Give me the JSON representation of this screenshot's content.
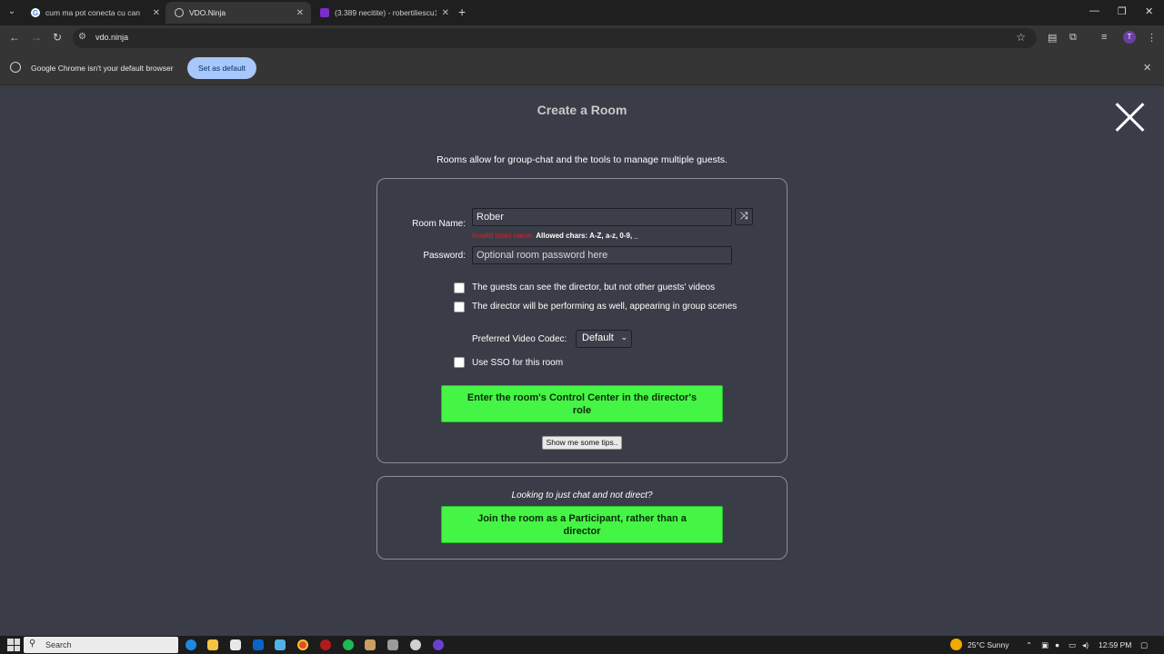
{
  "browser": {
    "tabs": [
      {
        "title": "cum ma pot conecta cu can",
        "favicon": "google-icon",
        "active": false
      },
      {
        "title": "VDO.Ninja",
        "favicon": "globe-icon",
        "active": true
      },
      {
        "title": "(3.389 necitite) - robertiliescu1(",
        "favicon": "yahoo-mail-icon",
        "active": false
      }
    ],
    "new_tab": "+",
    "url": "vdo.ninja",
    "profile_initial": "T"
  },
  "infobar": {
    "message": "Google Chrome isn't your default browser",
    "set_default_label": "Set as default"
  },
  "page": {
    "title": "Create a Room",
    "description": "Rooms allow for group-chat and the tools to manage multiple guests.",
    "room_name_label": "Room Name:",
    "room_name_value": "Rober",
    "shuffle_symbol": "⤨",
    "validation_invalid": "Invalid room name.",
    "validation_allowed": "Allowed chars: A-Z, a-z, 0-9, _",
    "password_label": "Password:",
    "password_placeholder": "Optional room password here",
    "checkbox_guests_see_director": "The guests can see the director, but not other guests' videos",
    "checkbox_director_performing": "The director will be performing as well, appearing in group scenes",
    "codec_label": "Preferred Video Codec:",
    "codec_value": "Default",
    "sso_label": "Use SSO for this room",
    "enter_director_button": "Enter the room's Control Center in the director's role",
    "tips_button": "Show me some tips..",
    "looking_text": "Looking to just chat and not direct?",
    "join_participant_button": "Join the room as a Participant, rather than a director"
  },
  "taskbar": {
    "search_label": "Search",
    "weather": "25°C  Sunny",
    "time": "12:59 PM"
  },
  "colors": {
    "page_bg": "#3a3c47",
    "green_button": "#45f545",
    "invalid_red": "#e0202a"
  }
}
